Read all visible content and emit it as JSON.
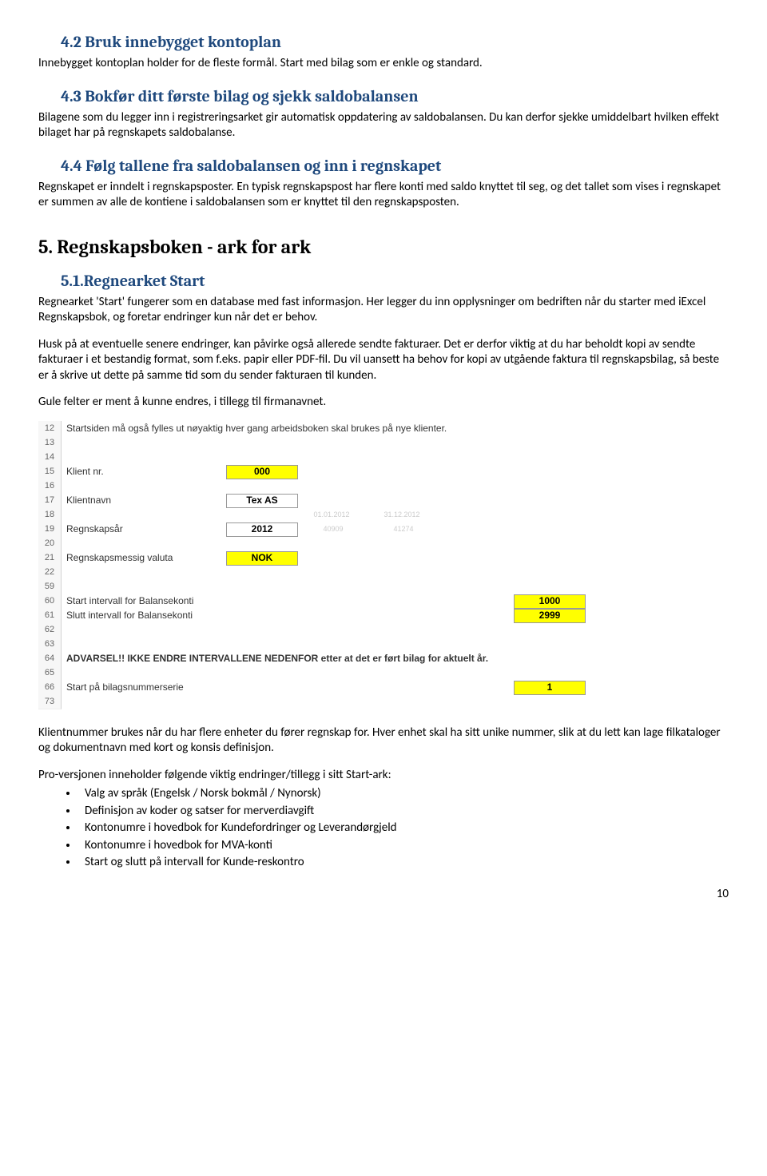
{
  "s42": {
    "title": "4.2 Bruk innebygget kontoplan",
    "body": "Innebygget kontoplan holder for de fleste formål. Start med bilag som er enkle og standard."
  },
  "s43": {
    "title": "4.3 Bokfør ditt første bilag og sjekk saldobalansen",
    "body": "Bilagene som du legger inn i registreringsarket gir automatisk oppdatering av saldobalansen. Du kan derfor sjekke umiddelbart hvilken effekt bilaget har på regnskapets saldobalanse."
  },
  "s44": {
    "title": "4.4 Følg tallene fra saldobalansen og inn i regnskapet",
    "body": "Regnskapet er inndelt i regnskapsposter. En typisk regnskapspost har flere konti med saldo knyttet til seg, og det tallet som vises i regnskapet er summen av alle de kontiene i saldobalansen som er knyttet til den regnskapsposten."
  },
  "s5": {
    "title": "5. Regnskapsboken - ark for ark"
  },
  "s51": {
    "title": "5.1.Regnearket Start",
    "p1": "Regnearket 'Start' fungerer som en database med fast informasjon. Her legger du inn opplysninger om bedriften når du starter med iExcel Regnskapsbok, og foretar endringer kun når det er behov.",
    "p2": "Husk på at eventuelle senere endringer, kan påvirke også allerede sendte fakturaer. Det er derfor viktig at du har beholdt kopi av sendte fakturaer i et bestandig format, som f.eks. papir eller PDF-fil. Du vil uansett ha behov for kopi av utgående faktura til regnskapsbilag, så beste er å skrive ut dette på samme tid som du sender fakturaen til kunden.",
    "p3": "Gule felter er ment å kunne endres, i tillegg til firmanavnet.",
    "p4": "Klientnummer brukes når du har flere enheter du fører regnskap for. Hver enhet skal ha sitt unike nummer, slik at du lett kan lage filkataloger og dokumentnavn med kort og konsis definisjon.",
    "p5": "Pro-versjonen inneholder følgende viktig endringer/tillegg i sitt Start-ark:"
  },
  "excel": {
    "note": "Startsiden må også fylles ut nøyaktig hver gang arbeidsboken skal brukes på nye klienter.",
    "rows": {
      "r15_label": "Klient nr.",
      "r15_val": "000",
      "r17_label": "Klientnavn",
      "r17_val": "Tex AS",
      "r18_f1": "01.01.2012",
      "r18_f2": "31.12.2012",
      "r19_label": "Regnskapsår",
      "r19_val": "2012",
      "r19_f1": "40909",
      "r19_f2": "41274",
      "r21_label": "Regnskapsmessig valuta",
      "r21_val": "NOK",
      "r60_label": "Start intervall for Balansekonti",
      "r60_val": "1000",
      "r61_label": "Slutt intervall for Balansekonti",
      "r61_val": "2999",
      "r64_warn": "ADVARSEL!! IKKE ENDRE INTERVALLENE NEDENFOR etter at det er ført bilag for aktuelt år.",
      "r66_label": "Start på  bilagsnummerserie",
      "r66_val": "1"
    }
  },
  "bullets": [
    "Valg av språk (Engelsk / Norsk bokmål / Nynorsk)",
    "Definisjon av koder og satser for merverdiavgift",
    "Kontonumre i hovedbok for Kundefordringer og Leverandørgjeld",
    "Kontonumre i hovedbok for MVA-konti",
    "Start og slutt på intervall for Kunde-reskontro"
  ],
  "pagenum": "10"
}
